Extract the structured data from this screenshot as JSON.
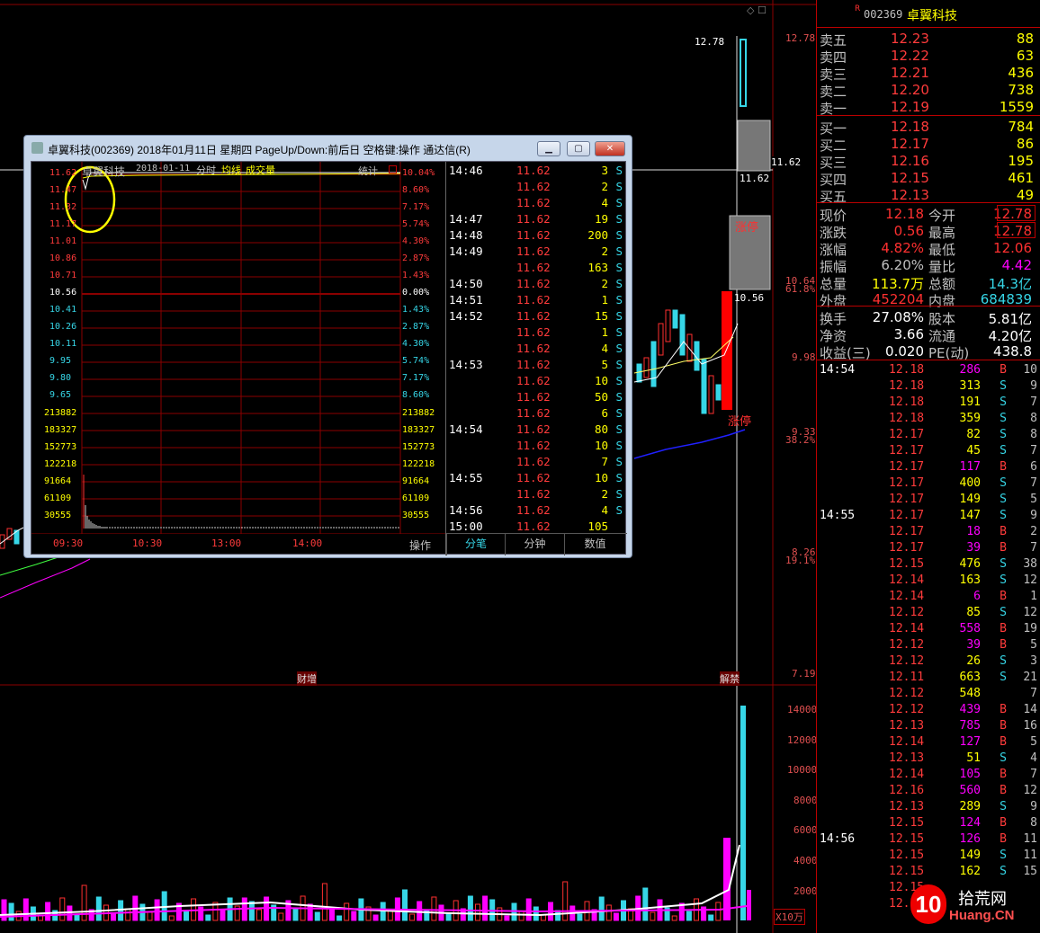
{
  "colors": {
    "up": "#ff3b3b",
    "down": "#36d6e7",
    "neutral": "#c0c0c0",
    "yellow": "#ffff00",
    "magenta": "#ff00ff",
    "bg": "#000000"
  },
  "main_chart": {
    "price_ticks": [
      "12.78",
      "11.62",
      "10.64",
      "9.98",
      "9.33",
      "8.26",
      "7.19"
    ],
    "pct_ticks": [
      "61.8%",
      "38.2%",
      "19.1%"
    ],
    "high_label": "12.78",
    "close_label": "11.62",
    "mid_label": "10.56",
    "limit_up_labels": [
      "涨停",
      "涨停"
    ],
    "event_labels": [
      "财增",
      "解禁"
    ],
    "vol_ticks": [
      "14000",
      "12000",
      "10000",
      "8000",
      "6000",
      "4000",
      "2000"
    ],
    "vol_unit": "X10万"
  },
  "stock": {
    "code": "002369",
    "name": "卓翼科技",
    "flag": "R"
  },
  "asks": [
    {
      "label": "卖五",
      "price": "12.23",
      "vol": "88"
    },
    {
      "label": "卖四",
      "price": "12.22",
      "vol": "63"
    },
    {
      "label": "卖三",
      "price": "12.21",
      "vol": "436"
    },
    {
      "label": "卖二",
      "price": "12.20",
      "vol": "738"
    },
    {
      "label": "卖一",
      "price": "12.19",
      "vol": "1559"
    }
  ],
  "bids": [
    {
      "label": "买一",
      "price": "12.18",
      "vol": "784"
    },
    {
      "label": "买二",
      "price": "12.17",
      "vol": "86"
    },
    {
      "label": "买三",
      "price": "12.16",
      "vol": "195"
    },
    {
      "label": "买四",
      "price": "12.15",
      "vol": "461"
    },
    {
      "label": "买五",
      "price": "12.13",
      "vol": "49"
    }
  ],
  "stats": [
    {
      "l1": "现价",
      "v1": "12.18",
      "l2": "今开",
      "v2": "12.78"
    },
    {
      "l1": "涨跌",
      "v1": "0.56",
      "l2": "最高",
      "v2": "12.78"
    },
    {
      "l1": "涨幅",
      "v1": "4.82%",
      "l2": "最低",
      "v2": "12.06"
    },
    {
      "l1": "振幅",
      "v1": "6.20%",
      "l2": "量比",
      "v2": "4.42"
    },
    {
      "l1": "总量",
      "v1": "113.7万",
      "l2": "总额",
      "v2": "14.3亿"
    },
    {
      "l1": "外盘",
      "v1": "452204",
      "l2": "内盘",
      "v2": "684839"
    }
  ],
  "stats2": [
    {
      "l1": "换手",
      "v1": "27.08%",
      "l2": "股本",
      "v2": "5.81亿"
    },
    {
      "l1": "净资",
      "v1": "3.66",
      "l2": "流通",
      "v2": "4.20亿"
    },
    {
      "l1": "收益(三)",
      "v1": "0.020",
      "l2": "PE(动)",
      "v2": "438.8"
    }
  ],
  "ticks": [
    {
      "t": "14:54",
      "p": "12.18",
      "v": "286",
      "s": "B",
      "n": "10"
    },
    {
      "t": "",
      "p": "12.18",
      "v": "313",
      "s": "S",
      "n": "9"
    },
    {
      "t": "",
      "p": "12.18",
      "v": "191",
      "s": "S",
      "n": "7"
    },
    {
      "t": "",
      "p": "12.18",
      "v": "359",
      "s": "S",
      "n": "8"
    },
    {
      "t": "",
      "p": "12.17",
      "v": "82",
      "s": "S",
      "n": "8"
    },
    {
      "t": "",
      "p": "12.17",
      "v": "45",
      "s": "S",
      "n": "7"
    },
    {
      "t": "",
      "p": "12.17",
      "v": "117",
      "s": "B",
      "n": "6"
    },
    {
      "t": "",
      "p": "12.17",
      "v": "400",
      "s": "S",
      "n": "7"
    },
    {
      "t": "",
      "p": "12.17",
      "v": "149",
      "s": "S",
      "n": "5"
    },
    {
      "t": "14:55",
      "p": "12.17",
      "v": "147",
      "s": "S",
      "n": "9"
    },
    {
      "t": "",
      "p": "12.17",
      "v": "18",
      "s": "B",
      "n": "2"
    },
    {
      "t": "",
      "p": "12.17",
      "v": "39",
      "s": "B",
      "n": "7"
    },
    {
      "t": "",
      "p": "12.15",
      "v": "476",
      "s": "S",
      "n": "38"
    },
    {
      "t": "",
      "p": "12.14",
      "v": "163",
      "s": "S",
      "n": "12"
    },
    {
      "t": "",
      "p": "12.14",
      "v": "6",
      "s": "B",
      "n": "1"
    },
    {
      "t": "",
      "p": "12.12",
      "v": "85",
      "s": "S",
      "n": "12"
    },
    {
      "t": "",
      "p": "12.14",
      "v": "558",
      "s": "B",
      "n": "19"
    },
    {
      "t": "",
      "p": "12.12",
      "v": "39",
      "s": "B",
      "n": "5"
    },
    {
      "t": "",
      "p": "12.12",
      "v": "26",
      "s": "S",
      "n": "3"
    },
    {
      "t": "",
      "p": "12.11",
      "v": "663",
      "s": "S",
      "n": "21"
    },
    {
      "t": "",
      "p": "12.12",
      "v": "548",
      "s": "",
      "n": "7"
    },
    {
      "t": "",
      "p": "12.12",
      "v": "439",
      "s": "B",
      "n": "14"
    },
    {
      "t": "",
      "p": "12.13",
      "v": "785",
      "s": "B",
      "n": "16"
    },
    {
      "t": "",
      "p": "12.14",
      "v": "127",
      "s": "B",
      "n": "5"
    },
    {
      "t": "",
      "p": "12.13",
      "v": "51",
      "s": "S",
      "n": "4"
    },
    {
      "t": "",
      "p": "12.14",
      "v": "105",
      "s": "B",
      "n": "7"
    },
    {
      "t": "",
      "p": "12.16",
      "v": "560",
      "s": "B",
      "n": "12"
    },
    {
      "t": "",
      "p": "12.13",
      "v": "289",
      "s": "S",
      "n": "9"
    },
    {
      "t": "",
      "p": "12.15",
      "v": "124",
      "s": "B",
      "n": "8"
    },
    {
      "t": "14:56",
      "p": "12.15",
      "v": "126",
      "s": "B",
      "n": "11"
    },
    {
      "t": "",
      "p": "12.15",
      "v": "149",
      "s": "S",
      "n": "11"
    },
    {
      "t": "",
      "p": "12.15",
      "v": "162",
      "s": "S",
      "n": "15"
    },
    {
      "t": "",
      "p": "12.15",
      "v": "",
      "s": "",
      "n": ""
    },
    {
      "t": "",
      "p": "12.1",
      "v": "",
      "s": "",
      "n": ""
    }
  ],
  "popup": {
    "title": "卓翼科技(002369) 2018年01月11日 星期四 PageUp/Down:前后日 空格键:操作 通达信(R)",
    "chart_name": "卓翼科技",
    "date": "2018-01-11",
    "labels": [
      "分时",
      "均线",
      "成交量"
    ],
    "stat_btn": "统计",
    "price_ticks": [
      "11.62",
      "11.47",
      "11.32",
      "11.17",
      "11.01",
      "10.86",
      "10.71",
      "10.56",
      "10.41",
      "10.26",
      "10.11",
      "9.95",
      "9.80",
      "9.65"
    ],
    "pct_ticks": [
      "10.04%",
      "8.60%",
      "7.17%",
      "5.74%",
      "4.30%",
      "2.87%",
      "1.43%",
      "0.00%",
      "1.43%",
      "2.87%",
      "4.30%",
      "5.74%",
      "7.17%",
      "8.60%"
    ],
    "vol_ticks": [
      "213882",
      "183327",
      "152773",
      "122218",
      "91664",
      "61109",
      "30555"
    ],
    "time_ticks": [
      "09:30",
      "10:30",
      "13:00",
      "14:00"
    ],
    "op_label": "操作",
    "tabs": [
      "分笔",
      "分钟",
      "数值"
    ],
    "trades": [
      {
        "t": "14:46",
        "p": "11.62",
        "v": "3",
        "s": "S"
      },
      {
        "t": "",
        "p": "11.62",
        "v": "2",
        "s": "S"
      },
      {
        "t": "",
        "p": "11.62",
        "v": "4",
        "s": "S"
      },
      {
        "t": "14:47",
        "p": "11.62",
        "v": "19",
        "s": "S"
      },
      {
        "t": "14:48",
        "p": "11.62",
        "v": "200",
        "s": "S"
      },
      {
        "t": "14:49",
        "p": "11.62",
        "v": "2",
        "s": "S"
      },
      {
        "t": "",
        "p": "11.62",
        "v": "163",
        "s": "S"
      },
      {
        "t": "14:50",
        "p": "11.62",
        "v": "2",
        "s": "S"
      },
      {
        "t": "14:51",
        "p": "11.62",
        "v": "1",
        "s": "S"
      },
      {
        "t": "14:52",
        "p": "11.62",
        "v": "15",
        "s": "S"
      },
      {
        "t": "",
        "p": "11.62",
        "v": "1",
        "s": "S"
      },
      {
        "t": "",
        "p": "11.62",
        "v": "4",
        "s": "S"
      },
      {
        "t": "14:53",
        "p": "11.62",
        "v": "5",
        "s": "S"
      },
      {
        "t": "",
        "p": "11.62",
        "v": "10",
        "s": "S"
      },
      {
        "t": "",
        "p": "11.62",
        "v": "50",
        "s": "S"
      },
      {
        "t": "",
        "p": "11.62",
        "v": "6",
        "s": "S"
      },
      {
        "t": "14:54",
        "p": "11.62",
        "v": "80",
        "s": "S"
      },
      {
        "t": "",
        "p": "11.62",
        "v": "10",
        "s": "S"
      },
      {
        "t": "",
        "p": "11.62",
        "v": "7",
        "s": "S"
      },
      {
        "t": "14:55",
        "p": "11.62",
        "v": "10",
        "s": "S"
      },
      {
        "t": "",
        "p": "11.62",
        "v": "2",
        "s": "S"
      },
      {
        "t": "14:56",
        "p": "11.62",
        "v": "4",
        "s": "S"
      },
      {
        "t": "15:00",
        "p": "11.62",
        "v": "105",
        "s": ""
      }
    ]
  },
  "watermark": {
    "num": "10",
    "cn": "拾荒网",
    "url": "Huang.CN"
  }
}
